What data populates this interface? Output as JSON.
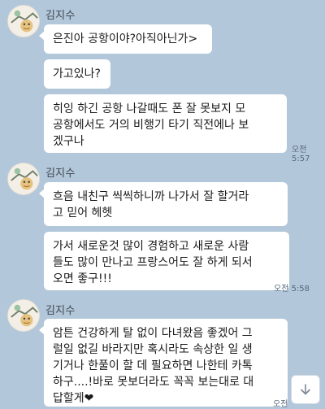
{
  "chat": {
    "groups": [
      {
        "sender": "김지수",
        "messages": [
          "은진아 공항이야?아직아닌가>",
          "가고있나?",
          "히잉 하긴 공항 나갈때도 폰 잘 못보지 모\n공항에서도 거의 비행기 타기 직전에나 보\n겠구나"
        ],
        "time": "오전 5:57"
      },
      {
        "sender": "김지수",
        "messages": [
          "흐음 내친구 씩씩하니까 나가서 잘 할거라\n고 믿어 헤헷",
          "가서 새로운것 많이 경험하고 새로운 사람\n들도 많이 만나고 프랑스어도 잘 하게 되서\n오면 좋구!!!"
        ],
        "time": "오전 5:58"
      },
      {
        "sender": "김지수",
        "messages": [
          "암튼 건강하게 탈 없이 다녀왔음 좋겠어 그\n럴일 없길 바라지만 혹시라도 속상한 일 생\n기거나 한풀이 할 데 필요하면 나한테 카톡\n하구....!바로 못보더라도 꼭꼭 보는대로 대\n답할게❤"
        ],
        "time": "오전"
      }
    ]
  },
  "colors": {
    "background": "#b2c7d9",
    "bubble": "#ffffff",
    "text": "#1a1a1a"
  },
  "icons": {
    "scroll_down": "arrow-down-icon",
    "avatar": "profile-avatar"
  }
}
